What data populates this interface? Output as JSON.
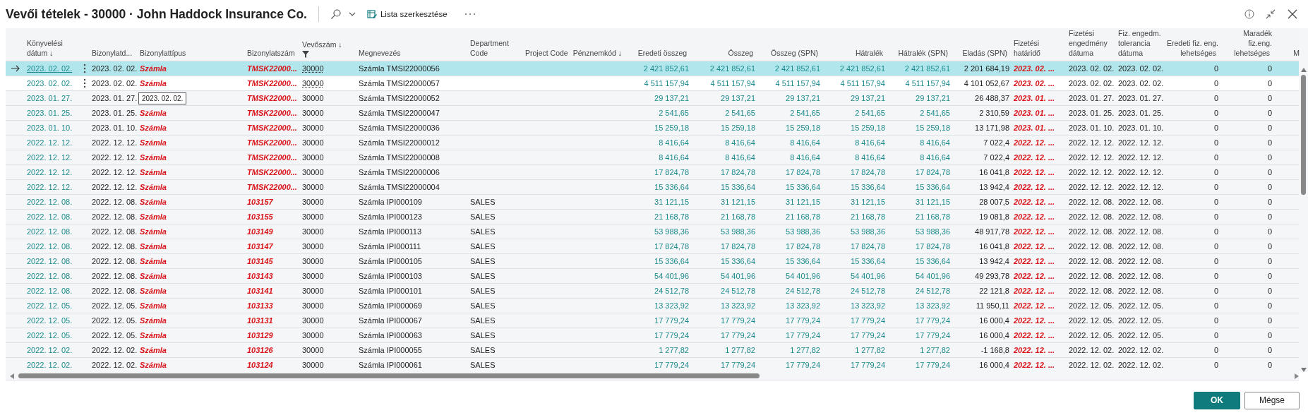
{
  "window": {
    "title": "Vevői tételek - 30000 · John Haddock Insurance Co.",
    "actions": [
      {
        "label": "Lista szerkesztése"
      }
    ]
  },
  "table": {
    "columns": [
      {
        "label": "Könyvelési\ndátum ↓",
        "filtered": false
      },
      {
        "label": "Bizonylatd...",
        "filtered": false
      },
      {
        "label": "Bizonylattípus",
        "filtered": false
      },
      {
        "label": "Bizonylatszám",
        "filtered": false
      },
      {
        "label": "Vevőszám ↓",
        "filtered": true
      },
      {
        "label": "Megnevezés",
        "filtered": false
      },
      {
        "label": "Department\nCode",
        "filtered": false
      },
      {
        "label": "Project Code",
        "filtered": false
      },
      {
        "label": "Pénznemkód ↓",
        "filtered": false
      },
      {
        "label": "Eredeti összeg",
        "filtered": false
      },
      {
        "label": "Összeg",
        "filtered": false
      },
      {
        "label": "Összeg (SPN)",
        "filtered": false
      },
      {
        "label": "Hátralék",
        "filtered": false
      },
      {
        "label": "Hátralék (SPN)",
        "filtered": false
      },
      {
        "label": "Eladás (SPN)",
        "filtered": false
      },
      {
        "label": "Fizetési\nhatáridő",
        "filtered": false
      },
      {
        "label": "Fizetési\nengedmény\ndátuma",
        "filtered": false
      },
      {
        "label": "Fiz. engedm.\ntolerancia\ndátuma",
        "filtered": false
      },
      {
        "label": "Eredeti fiz. eng.\nlehetséges",
        "filtered": false
      },
      {
        "label": "Maradék\nfiz.eng.\nlehetséges",
        "filtered": false
      },
      {
        "label": "M",
        "filtered": false
      }
    ],
    "rows": [
      {
        "selected": true,
        "hovered": false,
        "posting_date": "2023. 02. 02.",
        "document_date": "2023. 02. 02.",
        "document_type": "Számla",
        "document_no": "TMSK22000...",
        "customer_no": "30000",
        "description": "Számla TMSI22000056",
        "original_amount": "2 421 852,61",
        "amount": "2 421 852,61",
        "amount_spn": "2 421 852,61",
        "remaining": "2 421 852,61",
        "remaining_spn": "2 421 852,61",
        "sales_spn": "2 201 684,19",
        "due_date": "2023. 02. ...",
        "disc_date": "2023. 02. 02.",
        "disc_tolerance_date": "2023. 02. 02.",
        "orig_disc_possible": "0",
        "rem_disc_possible": "0"
      },
      {
        "selected": false,
        "hovered": true,
        "posting_date": "2023. 02. 02.",
        "document_date": "2023. 02. 02.",
        "document_type": "Számla",
        "document_no": "TMSK22000...",
        "customer_no": "30000",
        "description": "Számla TMSI22000057",
        "original_amount": "4 511 157,94",
        "amount": "4 511 157,94",
        "amount_spn": "4 511 157,94",
        "remaining": "4 511 157,94",
        "remaining_spn": "4 511 157,94",
        "sales_spn": "4 101 052,67",
        "due_date": "2023. 02. ...",
        "disc_date": "2023. 02. 02.",
        "disc_tolerance_date": "2023. 02. 02.",
        "orig_disc_possible": "0",
        "rem_disc_possible": "0"
      },
      {
        "selected": false,
        "hovered": false,
        "posting_date": "2023. 01. 27.",
        "document_date": "2023. 01. 27.",
        "tooltip": "2023. 02. 02.",
        "document_no": "TMSK22000...",
        "customer_no": "30000",
        "description": "Számla TMSI22000052",
        "original_amount": "29 137,21",
        "amount": "29 137,21",
        "amount_spn": "29 137,21",
        "remaining": "29 137,21",
        "remaining_spn": "29 137,21",
        "sales_spn": "26 488,37",
        "due_date": "2023. 01. ...",
        "disc_date": "2023. 01. 27.",
        "disc_tolerance_date": "2023. 01. 27.",
        "orig_disc_possible": "0",
        "rem_disc_possible": "0"
      },
      {
        "selected": false,
        "hovered": false,
        "posting_date": "2023. 01. 25.",
        "document_date": "2023. 01. 25.",
        "document_type": "Számla",
        "document_no": "TMSK22000...",
        "customer_no": "30000",
        "description": "Számla TMSI22000047",
        "original_amount": "2 541,65",
        "amount": "2 541,65",
        "amount_spn": "2 541,65",
        "remaining": "2 541,65",
        "remaining_spn": "2 541,65",
        "sales_spn": "2 310,59",
        "due_date": "2023. 01. ...",
        "disc_date": "2023. 01. 25.",
        "disc_tolerance_date": "2023. 01. 25.",
        "orig_disc_possible": "0",
        "rem_disc_possible": "0"
      },
      {
        "selected": false,
        "hovered": false,
        "posting_date": "2023. 01. 10.",
        "document_date": "2023. 01. 10.",
        "document_type": "Számla",
        "document_no": "TMSK22000...",
        "customer_no": "30000",
        "description": "Számla TMSI22000036",
        "original_amount": "15 259,18",
        "amount": "15 259,18",
        "amount_spn": "15 259,18",
        "remaining": "15 259,18",
        "remaining_spn": "15 259,18",
        "sales_spn": "13 171,98",
        "due_date": "2023. 01. ...",
        "disc_date": "2023. 01. 10.",
        "disc_tolerance_date": "2023. 01. 10.",
        "orig_disc_possible": "0",
        "rem_disc_possible": "0"
      },
      {
        "selected": false,
        "hovered": false,
        "posting_date": "2022. 12. 12.",
        "document_date": "2022. 12. 12.",
        "document_type": "Számla",
        "document_no": "TMSK22000...",
        "customer_no": "30000",
        "description": "Számla TMSI22000012",
        "original_amount": "8 416,64",
        "amount": "8 416,64",
        "amount_spn": "8 416,64",
        "remaining": "8 416,64",
        "remaining_spn": "8 416,64",
        "sales_spn": "7 022,4",
        "due_date": "2022. 12. ...",
        "disc_date": "2022. 12. 12.",
        "disc_tolerance_date": "2022. 12. 12.",
        "orig_disc_possible": "0",
        "rem_disc_possible": "0"
      },
      {
        "selected": false,
        "hovered": false,
        "posting_date": "2022. 12. 12.",
        "document_date": "2022. 12. 12.",
        "document_type": "Számla",
        "document_no": "TMSK22000...",
        "customer_no": "30000",
        "description": "Számla TMSI22000008",
        "original_amount": "8 416,64",
        "amount": "8 416,64",
        "amount_spn": "8 416,64",
        "remaining": "8 416,64",
        "remaining_spn": "8 416,64",
        "sales_spn": "7 022,4",
        "due_date": "2022. 12. ...",
        "disc_date": "2022. 12. 12.",
        "disc_tolerance_date": "2022. 12. 12.",
        "orig_disc_possible": "0",
        "rem_disc_possible": "0"
      },
      {
        "selected": false,
        "hovered": false,
        "posting_date": "2022. 12. 12.",
        "document_date": "2022. 12. 12.",
        "document_type": "Számla",
        "document_no": "TMSK22000...",
        "customer_no": "30000",
        "description": "Számla TMSI22000006",
        "original_amount": "17 824,78",
        "amount": "17 824,78",
        "amount_spn": "17 824,78",
        "remaining": "17 824,78",
        "remaining_spn": "17 824,78",
        "sales_spn": "16 041,8",
        "due_date": "2022. 12. ...",
        "disc_date": "2022. 12. 12.",
        "disc_tolerance_date": "2022. 12. 12.",
        "orig_disc_possible": "0",
        "rem_disc_possible": "0"
      },
      {
        "selected": false,
        "hovered": false,
        "posting_date": "2022. 12. 12.",
        "document_date": "2022. 12. 12.",
        "document_type": "Számla",
        "document_no": "TMSK22000...",
        "customer_no": "30000",
        "description": "Számla TMSI22000004",
        "original_amount": "15 336,64",
        "amount": "15 336,64",
        "amount_spn": "15 336,64",
        "remaining": "15 336,64",
        "remaining_spn": "15 336,64",
        "sales_spn": "13 942,4",
        "due_date": "2022. 12. ...",
        "disc_date": "2022. 12. 12.",
        "disc_tolerance_date": "2022. 12. 12.",
        "orig_disc_possible": "0",
        "rem_disc_possible": "0"
      },
      {
        "selected": false,
        "hovered": false,
        "posting_date": "2022. 12. 08.",
        "document_date": "2022. 12. 08.",
        "document_type": "Számla",
        "document_no": "103157",
        "customer_no": "30000",
        "description": "Számla IPI000109",
        "department_code": "SALES",
        "original_amount": "31 121,15",
        "amount": "31 121,15",
        "amount_spn": "31 121,15",
        "remaining": "31 121,15",
        "remaining_spn": "31 121,15",
        "sales_spn": "28 007,5",
        "due_date": "2022. 12. ...",
        "disc_date": "2022. 12. 08.",
        "disc_tolerance_date": "2022. 12. 08.",
        "orig_disc_possible": "0",
        "rem_disc_possible": "0"
      },
      {
        "selected": false,
        "hovered": false,
        "posting_date": "2022. 12. 08.",
        "document_date": "2022. 12. 08.",
        "document_type": "Számla",
        "document_no": "103155",
        "customer_no": "30000",
        "description": "Számla IPI000123",
        "department_code": "SALES",
        "original_amount": "21 168,78",
        "amount": "21 168,78",
        "amount_spn": "21 168,78",
        "remaining": "21 168,78",
        "remaining_spn": "21 168,78",
        "sales_spn": "19 081,8",
        "due_date": "2022. 12. ...",
        "disc_date": "2022. 12. 08.",
        "disc_tolerance_date": "2022. 12. 08.",
        "orig_disc_possible": "0",
        "rem_disc_possible": "0"
      },
      {
        "selected": false,
        "hovered": false,
        "posting_date": "2022. 12. 08.",
        "document_date": "2022. 12. 08.",
        "document_type": "Számla",
        "document_no": "103149",
        "customer_no": "30000",
        "description": "Számla IPI000113",
        "department_code": "SALES",
        "original_amount": "53 988,36",
        "amount": "53 988,36",
        "amount_spn": "53 988,36",
        "remaining": "53 988,36",
        "remaining_spn": "53 988,36",
        "sales_spn": "48 917,78",
        "due_date": "2022. 12. ...",
        "disc_date": "2022. 12. 08.",
        "disc_tolerance_date": "2022. 12. 08.",
        "orig_disc_possible": "0",
        "rem_disc_possible": "0"
      },
      {
        "selected": false,
        "hovered": false,
        "posting_date": "2022. 12. 08.",
        "document_date": "2022. 12. 08.",
        "document_type": "Számla",
        "document_no": "103147",
        "customer_no": "30000",
        "description": "Számla IPI000111",
        "department_code": "SALES",
        "original_amount": "17 824,78",
        "amount": "17 824,78",
        "amount_spn": "17 824,78",
        "remaining": "17 824,78",
        "remaining_spn": "17 824,78",
        "sales_spn": "16 041,8",
        "due_date": "2022. 12. ...",
        "disc_date": "2022. 12. 08.",
        "disc_tolerance_date": "2022. 12. 08.",
        "orig_disc_possible": "0",
        "rem_disc_possible": "0"
      },
      {
        "selected": false,
        "hovered": false,
        "posting_date": "2022. 12. 08.",
        "document_date": "2022. 12. 08.",
        "document_type": "Számla",
        "document_no": "103145",
        "customer_no": "30000",
        "description": "Számla IPI000105",
        "department_code": "SALES",
        "original_amount": "15 336,64",
        "amount": "15 336,64",
        "amount_spn": "15 336,64",
        "remaining": "15 336,64",
        "remaining_spn": "15 336,64",
        "sales_spn": "13 942,4",
        "due_date": "2022. 12. ...",
        "disc_date": "2022. 12. 08.",
        "disc_tolerance_date": "2022. 12. 08.",
        "orig_disc_possible": "0",
        "rem_disc_possible": "0"
      },
      {
        "selected": false,
        "hovered": false,
        "posting_date": "2022. 12. 08.",
        "document_date": "2022. 12. 08.",
        "document_type": "Számla",
        "document_no": "103143",
        "customer_no": "30000",
        "description": "Számla IPI000103",
        "department_code": "SALES",
        "original_amount": "54 401,96",
        "amount": "54 401,96",
        "amount_spn": "54 401,96",
        "remaining": "54 401,96",
        "remaining_spn": "54 401,96",
        "sales_spn": "49 293,78",
        "due_date": "2022. 12. ...",
        "disc_date": "2022. 12. 08.",
        "disc_tolerance_date": "2022. 12. 08.",
        "orig_disc_possible": "0",
        "rem_disc_possible": "0"
      },
      {
        "selected": false,
        "hovered": false,
        "posting_date": "2022. 12. 08.",
        "document_date": "2022. 12. 08.",
        "document_type": "Számla",
        "document_no": "103141",
        "customer_no": "30000",
        "description": "Számla IPI000101",
        "department_code": "SALES",
        "original_amount": "24 512,78",
        "amount": "24 512,78",
        "amount_spn": "24 512,78",
        "remaining": "24 512,78",
        "remaining_spn": "24 512,78",
        "sales_spn": "22 121,8",
        "due_date": "2022. 12. ...",
        "disc_date": "2022. 12. 08.",
        "disc_tolerance_date": "2022. 12. 08.",
        "orig_disc_possible": "0",
        "rem_disc_possible": "0"
      },
      {
        "selected": false,
        "hovered": false,
        "posting_date": "2022. 12. 05.",
        "document_date": "2022. 12. 05.",
        "document_type": "Számla",
        "document_no": "103133",
        "customer_no": "30000",
        "description": "Számla IPI000069",
        "department_code": "SALES",
        "original_amount": "13 323,92",
        "amount": "13 323,92",
        "amount_spn": "13 323,92",
        "remaining": "13 323,92",
        "remaining_spn": "13 323,92",
        "sales_spn": "11 950,11",
        "due_date": "2022. 12. ...",
        "disc_date": "2022. 12. 05.",
        "disc_tolerance_date": "2022. 12. 05.",
        "orig_disc_possible": "0",
        "rem_disc_possible": "0"
      },
      {
        "selected": false,
        "hovered": false,
        "posting_date": "2022. 12. 05.",
        "document_date": "2022. 12. 05.",
        "document_type": "Számla",
        "document_no": "103131",
        "customer_no": "30000",
        "description": "Számla IPI000067",
        "department_code": "SALES",
        "original_amount": "17 779,24",
        "amount": "17 779,24",
        "amount_spn": "17 779,24",
        "remaining": "17 779,24",
        "remaining_spn": "17 779,24",
        "sales_spn": "16 000,4",
        "due_date": "2022. 12. ...",
        "disc_date": "2022. 12. 05.",
        "disc_tolerance_date": "2022. 12. 05.",
        "orig_disc_possible": "0",
        "rem_disc_possible": "0"
      },
      {
        "selected": false,
        "hovered": false,
        "posting_date": "2022. 12. 05.",
        "document_date": "2022. 12. 05.",
        "document_type": "Számla",
        "document_no": "103129",
        "customer_no": "30000",
        "description": "Számla IPI000063",
        "department_code": "SALES",
        "original_amount": "17 779,24",
        "amount": "17 779,24",
        "amount_spn": "17 779,24",
        "remaining": "17 779,24",
        "remaining_spn": "17 779,24",
        "sales_spn": "16 000,4",
        "due_date": "2022. 12. ...",
        "disc_date": "2022. 12. 05.",
        "disc_tolerance_date": "2022. 12. 05.",
        "orig_disc_possible": "0",
        "rem_disc_possible": "0"
      },
      {
        "selected": false,
        "hovered": false,
        "posting_date": "2022. 12. 02.",
        "document_date": "2022. 12. 02.",
        "document_type": "Számla",
        "document_no": "103126",
        "customer_no": "30000",
        "description": "Számla IPI000055",
        "department_code": "SALES",
        "original_amount": "1 277,82",
        "amount": "1 277,82",
        "amount_spn": "1 277,82",
        "remaining": "1 277,82",
        "remaining_spn": "1 277,82",
        "sales_spn": "-1 168,8",
        "due_date": "2022. 12. ...",
        "disc_date": "2022. 12. 02.",
        "disc_tolerance_date": "2022. 12. 02.",
        "orig_disc_possible": "0",
        "rem_disc_possible": "0"
      },
      {
        "selected": false,
        "hovered": false,
        "posting_date": "2022. 12. 02.",
        "document_date": "2022. 12. 02.",
        "document_type": "Számla",
        "document_no": "103124",
        "customer_no": "30000",
        "description": "Számla IPI000061",
        "department_code": "SALES",
        "original_amount": "17 779,24",
        "amount": "17 779,24",
        "amount_spn": "17 779,24",
        "remaining": "17 779,24",
        "remaining_spn": "17 779,24",
        "sales_spn": "16 000,4",
        "due_date": "2022. 12. ...",
        "disc_date": "2022. 12. 02.",
        "disc_tolerance_date": "2022. 12. 02.",
        "orig_disc_possible": "0",
        "rem_disc_possible": "0"
      }
    ]
  },
  "buttons": [
    {
      "label": "OK",
      "kind": "primary"
    },
    {
      "label": "Mégse",
      "kind": "secondary"
    }
  ]
}
